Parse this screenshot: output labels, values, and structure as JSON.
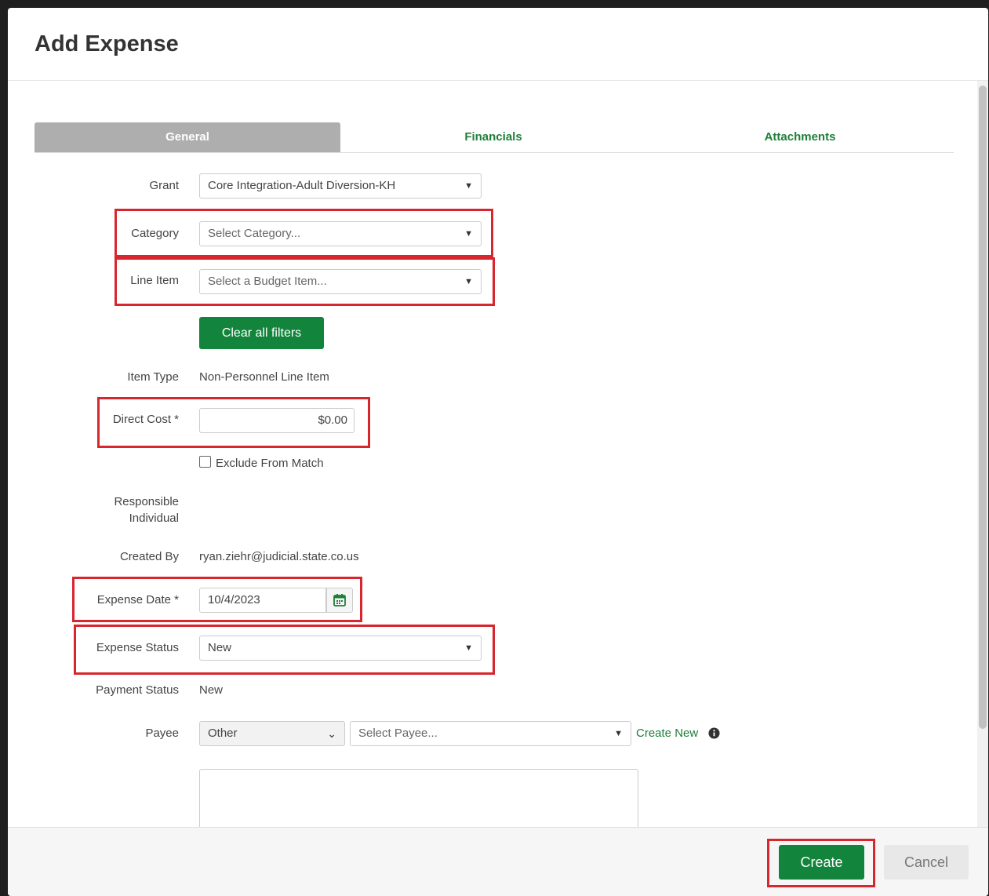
{
  "modal": {
    "title": "Add Expense"
  },
  "tabs": [
    {
      "label": "General",
      "active": true
    },
    {
      "label": "Financials",
      "active": false
    },
    {
      "label": "Attachments",
      "active": false
    }
  ],
  "form": {
    "grant": {
      "label": "Grant",
      "value": "Core Integration-Adult Diversion-KH"
    },
    "category": {
      "label": "Category",
      "placeholder": "Select Category..."
    },
    "line_item": {
      "label": "Line Item",
      "placeholder": "Select a Budget Item..."
    },
    "clear_filters_label": "Clear all filters",
    "item_type": {
      "label": "Item Type",
      "value": "Non-Personnel Line Item"
    },
    "direct_cost": {
      "label": "Direct Cost *",
      "value": "$0.00"
    },
    "exclude_match": {
      "label": "Exclude From Match",
      "checked": false
    },
    "responsible": {
      "label_line1": "Responsible",
      "label_line2": "Individual"
    },
    "created_by": {
      "label": "Created By",
      "value": "ryan.ziehr@judicial.state.co.us"
    },
    "expense_date": {
      "label": "Expense Date *",
      "value": "10/4/2023"
    },
    "expense_status": {
      "label": "Expense Status",
      "value": "New"
    },
    "payment_status": {
      "label": "Payment Status",
      "value": "New"
    },
    "payee": {
      "label": "Payee",
      "type_value": "Other",
      "placeholder": "Select Payee...",
      "create_new_label": "Create New"
    }
  },
  "footer": {
    "create_label": "Create",
    "cancel_label": "Cancel"
  },
  "colors": {
    "accent_green": "#12843c",
    "highlight_red": "#d7262e",
    "tab_active": "#aeaeae"
  }
}
